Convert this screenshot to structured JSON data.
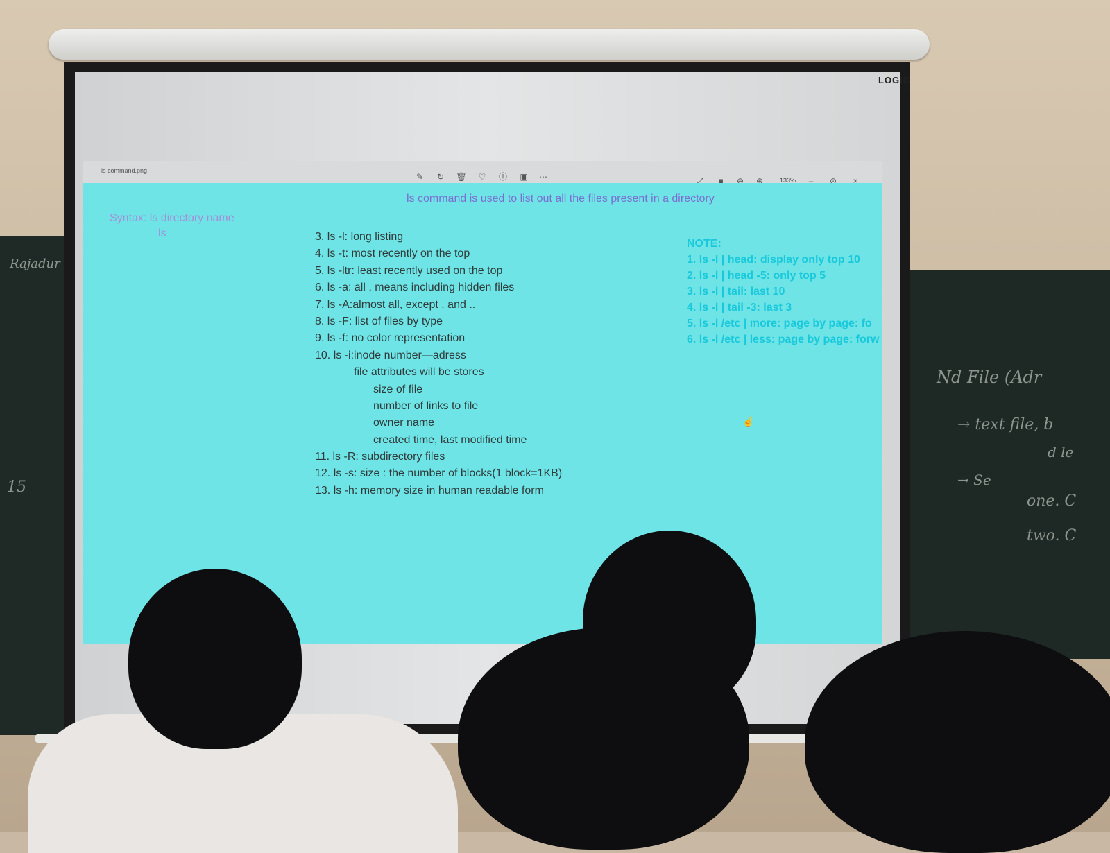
{
  "projector": {
    "brand": "LOGIC"
  },
  "viewer": {
    "filename": "ls command.png",
    "toolbar_icons": [
      "edit-icon",
      "rotate-icon",
      "trash-icon",
      "heart-icon",
      "info-icon",
      "crop-icon",
      "more-icon"
    ],
    "window_icons": [
      "expand-icon",
      "fit-icon",
      "zoom-out-icon",
      "zoom-in-icon"
    ],
    "zoom_level": "133%",
    "minimize_label": "–",
    "maximize_label": "⊙",
    "close_label": "×"
  },
  "slide": {
    "headline": "ls command is used to list out all the files present in a directory",
    "syntax": {
      "label": "Syntax: ls directory name",
      "example": "ls"
    },
    "list_items": [
      "3. ls -l: long listing",
      "4. ls -t: most recently on the top",
      "5. ls -ltr: least recently used on the top",
      "6. ls -a: all , means including hidden files",
      "7. ls -A:almost all, except . and ..",
      "8. ls -F: list of files by type",
      "9. ls -f: no color representation",
      "10. ls -i:inode number—adress",
      "file attributes will be stores",
      "size of file",
      "number of links to file",
      "owner name",
      "created time, last modified time",
      "11. ls -R: subdirectory files",
      "12. ls -s: size : the number of blocks(1 block=1KB)",
      "13. ls -h: memory size in human readable form"
    ],
    "note": {
      "heading": "NOTE:",
      "items": [
        "1. ls -l | head: display only top 10",
        "2. ls -l | head -5: only top 5",
        "3. ls -l | tail: last 10",
        "4. ls -l | tail -3: last 3",
        "5. ls -l /etc | more: page by page: fo",
        "6. ls -l /etc | less: page by page: forw"
      ]
    }
  },
  "blackboard": {
    "left_text": [
      "Rajadur",
      "15"
    ],
    "right_text": [
      "Nd File (Adr",
      "→ text file, b",
      "d le",
      "→ Se",
      "one. C",
      "two. C"
    ]
  }
}
